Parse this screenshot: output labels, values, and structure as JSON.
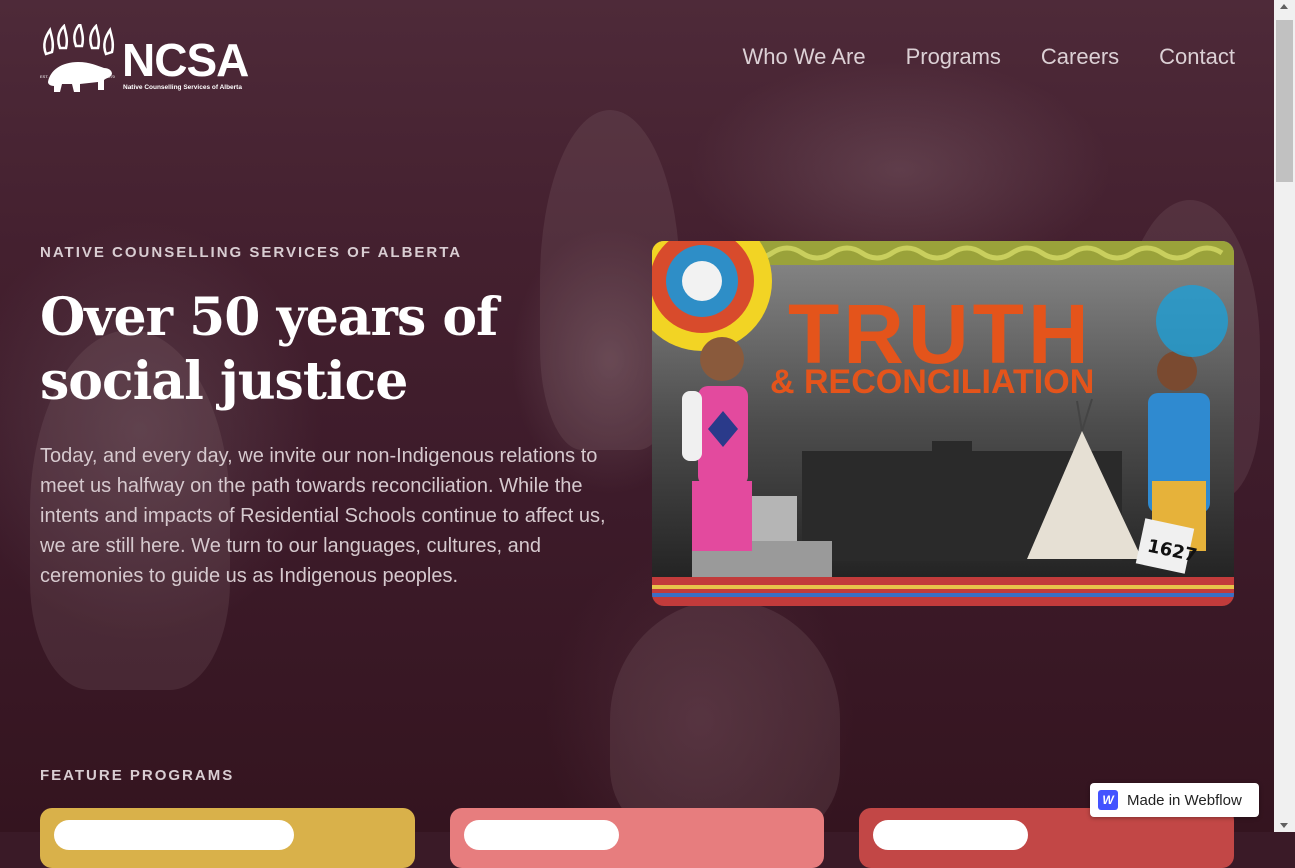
{
  "brand": {
    "name": "NCSA",
    "subtitle": "Native Counselling Services of Alberta",
    "est_label": "EST.",
    "est_year": "1970",
    "icon": "bear-paw-logo"
  },
  "nav": {
    "items": [
      {
        "label": "Who We Are"
      },
      {
        "label": "Programs"
      },
      {
        "label": "Careers"
      },
      {
        "label": "Contact"
      }
    ]
  },
  "hero": {
    "eyebrow": "NATIVE COUNSELLING SERVICES OF ALBERTA",
    "headline": "Over 50 years of social justice",
    "body": "Today, and every day, we invite our non-Indigenous relations to meet us halfway on the path towards reconciliation. While the intents and impacts of Residential Schools continue to affect us, we are still here. We turn to our languages, cultures, and ceremonies to guide us as Indigenous peoples.",
    "image": {
      "title": "TRUTH",
      "subtitle": "& RECONCILIATION",
      "number": "1627"
    }
  },
  "features": {
    "label": "FEATURE PROGRAMS"
  },
  "colors": {
    "background": "#3a1a27",
    "card_yellow": "#d9b14a",
    "card_pink": "#e77d7e",
    "card_red": "#c24746",
    "webflow_blue": "#4353ff"
  },
  "badge": {
    "icon": "W",
    "label": "Made in Webflow"
  }
}
